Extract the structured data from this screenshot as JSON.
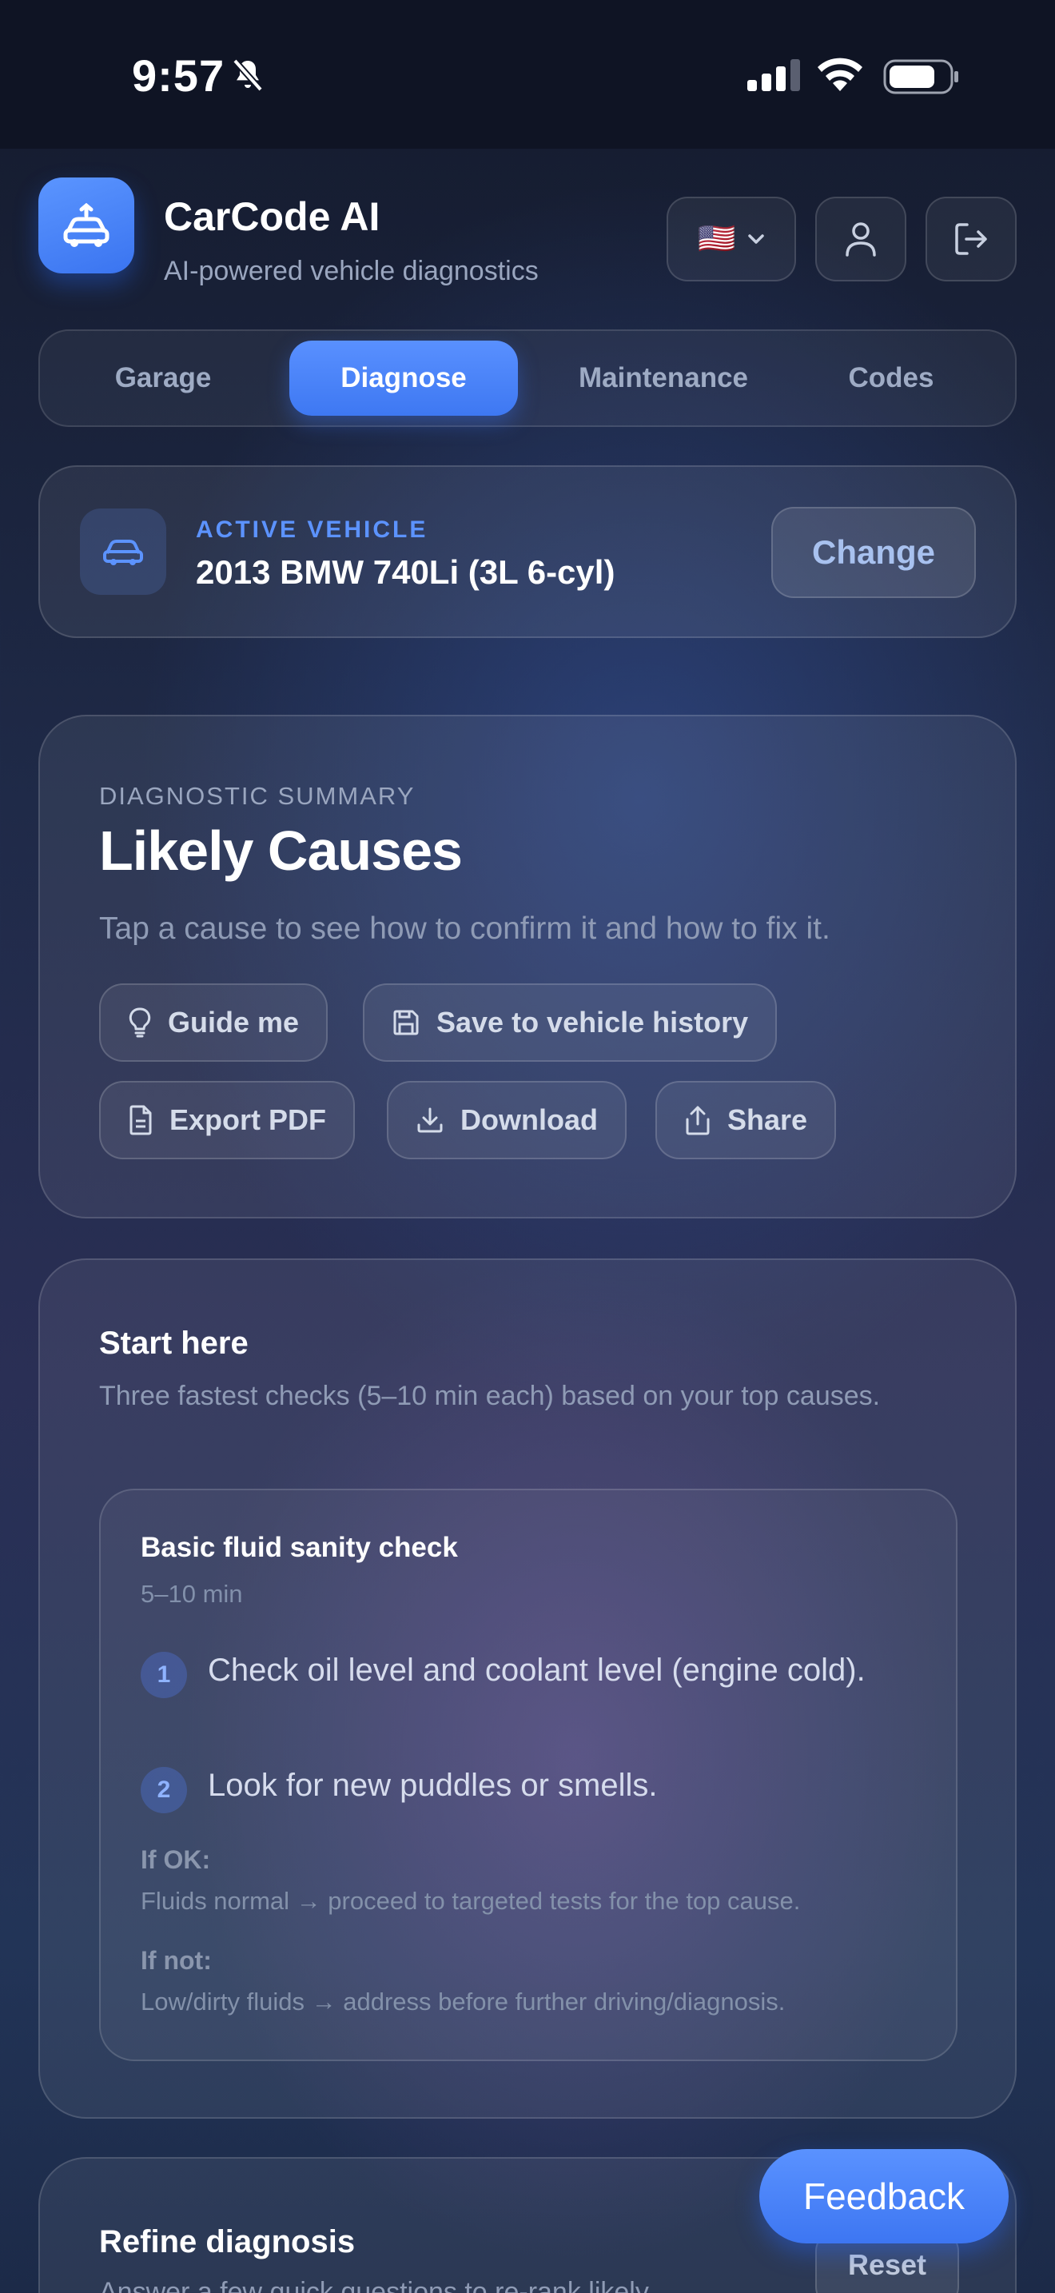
{
  "status_bar": {
    "time": "9:57"
  },
  "app": {
    "title": "CarCode AI",
    "subtitle": "AI-powered vehicle diagnostics",
    "flag": "🇺🇸"
  },
  "tabs": [
    {
      "label": "Garage",
      "active": false
    },
    {
      "label": "Diagnose",
      "active": true
    },
    {
      "label": "Maintenance",
      "active": false
    },
    {
      "label": "Codes",
      "active": false
    }
  ],
  "vehicle": {
    "label": "ACTIVE VEHICLE",
    "name": "2013 BMW 740Li (3L 6-cyl)",
    "change_label": "Change"
  },
  "summary": {
    "eyebrow": "DIAGNOSTIC SUMMARY",
    "title": "Likely Causes",
    "description": "Tap a cause to see how to confirm it and how to fix it.",
    "actions": {
      "guide": "Guide me",
      "save": "Save to vehicle history",
      "export": "Export PDF",
      "download": "Download",
      "share": "Share"
    }
  },
  "start_here": {
    "title": "Start here",
    "description": "Three fastest checks (5–10 min each) based on your top causes.",
    "check": {
      "title": "Basic fluid sanity check",
      "duration": "5–10 min",
      "steps": [
        {
          "num": "1",
          "text": "Check oil level and coolant level (engine cold)."
        },
        {
          "num": "2",
          "text": "Look for new puddles or smells."
        }
      ],
      "if_ok_label": "If OK:",
      "if_ok_text": "Fluids normal → proceed to targeted tests for the top cause.",
      "if_not_label": "If not:",
      "if_not_text": "Low/dirty fluids → address before further driving/diagnosis."
    }
  },
  "refine": {
    "title": "Refine diagnosis",
    "description": "Answer a few quick questions to re-rank likely",
    "reset_label": "Reset"
  },
  "feedback_label": "Feedback",
  "colors": {
    "accent": "#4a84fa",
    "accent_text": "#5c93ff"
  }
}
